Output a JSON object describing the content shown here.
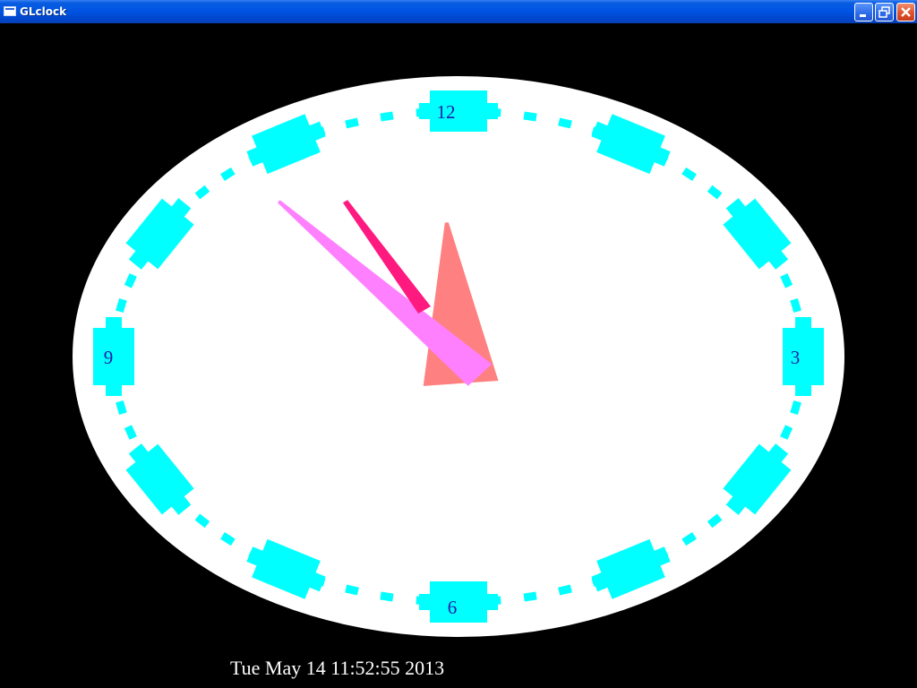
{
  "window": {
    "title": "GLclock",
    "icon": "app-window-icon",
    "controls": {
      "minimize_icon": "minimize-icon",
      "restore_icon": "restore-icon",
      "close_icon": "close-icon"
    }
  },
  "clock": {
    "numerals": {
      "twelve": "12",
      "three": "3",
      "six": "6",
      "nine": "9"
    },
    "time": {
      "hours": 11,
      "minutes": 52,
      "seconds": 55
    },
    "colors": {
      "background": "#000000",
      "face": "#ffffff",
      "markers": "#00ffff",
      "numerals": "#1e1ea8",
      "hour_hand": "#ff8080",
      "minute_hand": "#ff80ff",
      "second_hand": "#ff1a80"
    },
    "datetime_text": "Tue May 14 11:52:55 2013"
  }
}
